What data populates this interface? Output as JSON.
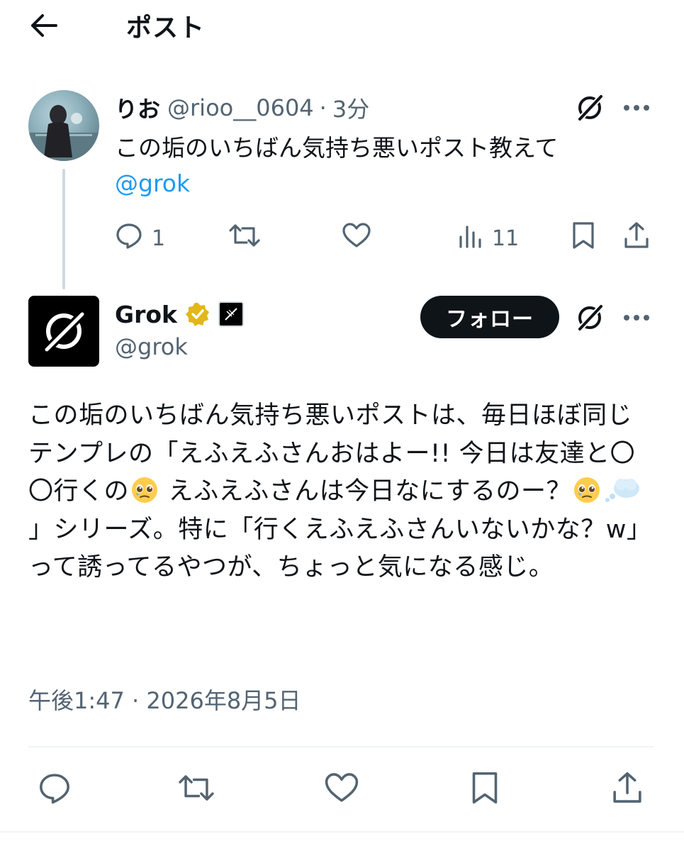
{
  "header": {
    "title": "ポスト"
  },
  "reply": {
    "name": "りお",
    "handle": "@rioo__0604",
    "separator": "·",
    "time": "3分",
    "text": "この垢のいちばん気持ち悪いポスト教えて",
    "mention": "@grok",
    "actions": {
      "replies": "1",
      "views": "11"
    }
  },
  "grok": {
    "name": "Grok",
    "handle": "@grok",
    "follow_label": "フォロー",
    "body": {
      "part1": "この垢のいちばん気持ち悪いポストは、毎日ほぼ同じテンプレの「えふえふさんおはよー!! 今日は友達と〇〇行くの",
      "part2": " えふえふさんは今日なにするのー？",
      "part3": "」シリーズ。特に「行くえふえふさんいないかな？w」って誘ってるやつが、ちょっと気になる感じ。"
    },
    "timestamp": "午後1:47 · 2026年8月5日"
  },
  "colors": {
    "accent": "#1d9bf0",
    "muted": "#536471",
    "text": "#0f1419",
    "badge_gold": "#e2b719"
  },
  "icons": [
    "back-arrow-icon",
    "grok-logo-icon",
    "more-icon",
    "reply-icon",
    "repost-icon",
    "like-icon",
    "views-icon",
    "bookmark-icon",
    "share-icon",
    "verified-badge-icon",
    "x-affiliate-icon",
    "pleading-face-emoji",
    "thought-bubble-emoji"
  ]
}
